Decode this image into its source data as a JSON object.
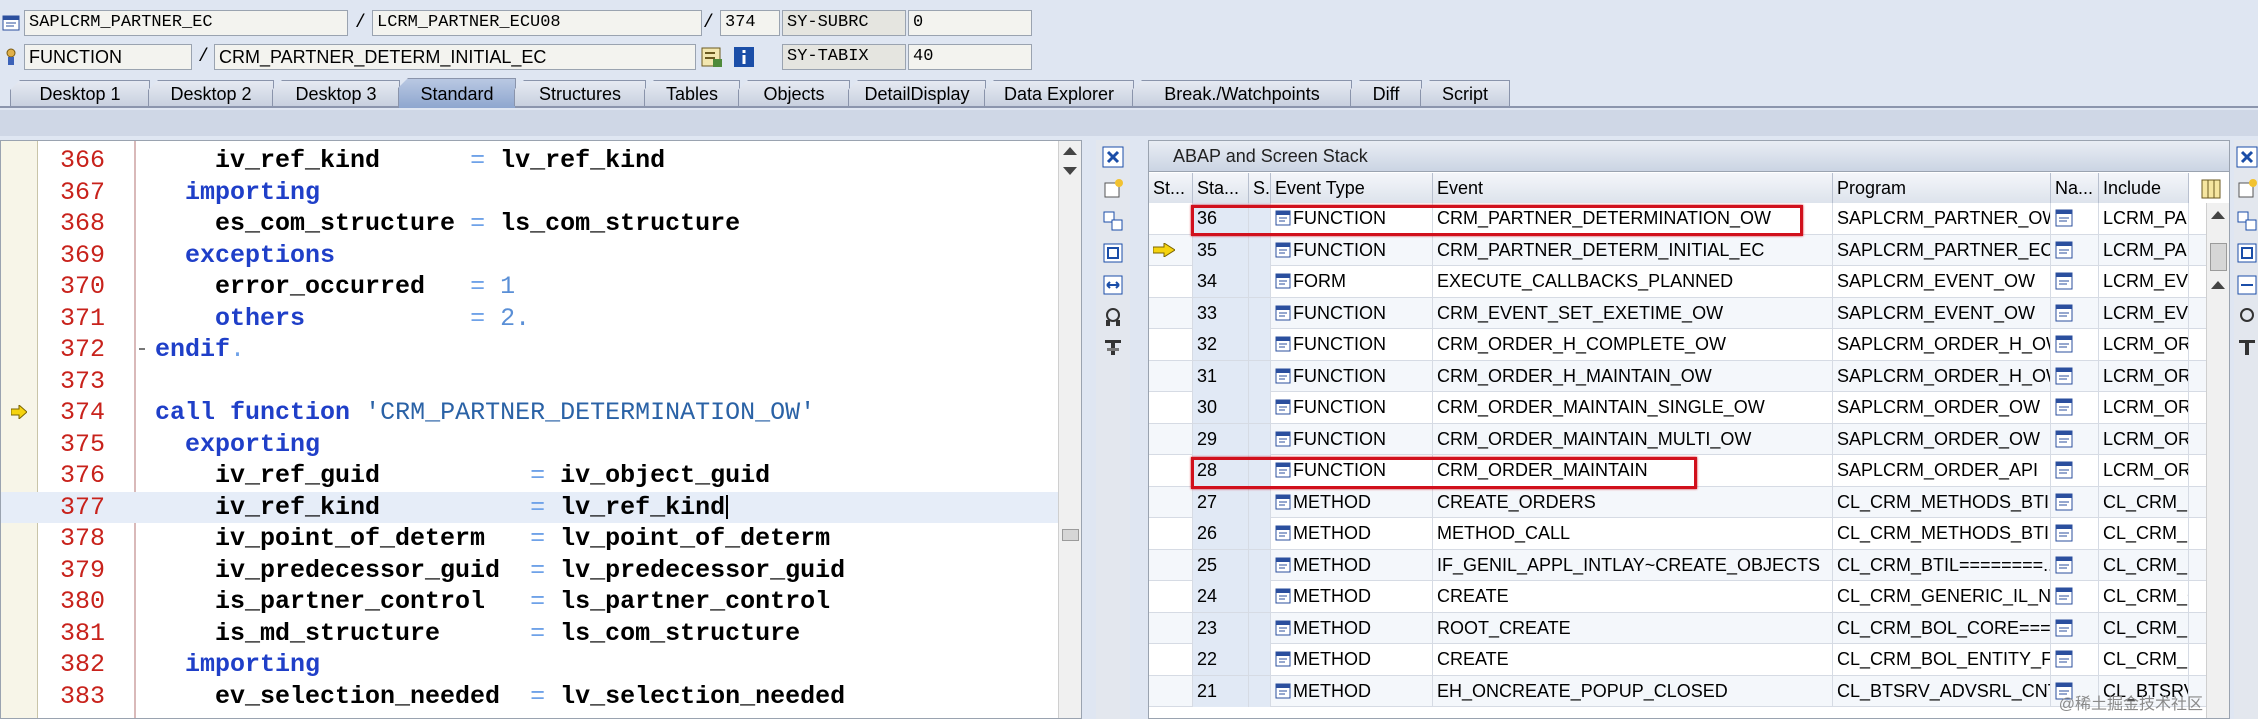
{
  "header": {
    "row1": {
      "program": "SAPLCRM_PARTNER_EC",
      "include": "LCRM_PARTNER_ECU08",
      "line": "374",
      "sysvar": "SY-SUBRC",
      "sysval": "0"
    },
    "row2": {
      "event_type": "FUNCTION",
      "event": "CRM_PARTNER_DETERM_INITIAL_EC",
      "sysvar": "SY-TABIX",
      "sysval": "40"
    },
    "sep": "/"
  },
  "tabs": [
    "Desktop 1",
    "Desktop 2",
    "Desktop 3",
    "Standard",
    "Structures",
    "Tables",
    "Objects",
    "DetailDisplay",
    "Data Explorer",
    "Break./Watchpoints",
    "Diff",
    "Script"
  ],
  "active_tab": "Standard",
  "code": {
    "lines": [
      {
        "n": "366",
        "text": "    iv_ref_kind      = lv_ref_kind"
      },
      {
        "n": "367",
        "text": "  importing"
      },
      {
        "n": "368",
        "text": "    es_com_structure = ls_com_structure"
      },
      {
        "n": "369",
        "text": "  exceptions"
      },
      {
        "n": "370",
        "text": "    error_occurred   = 1"
      },
      {
        "n": "371",
        "text": "    others           = 2."
      },
      {
        "n": "372",
        "text": "endif."
      },
      {
        "n": "373",
        "text": ""
      },
      {
        "n": "374",
        "text": "call function 'CRM_PARTNER_DETERMINATION_OW'"
      },
      {
        "n": "375",
        "text": "  exporting"
      },
      {
        "n": "376",
        "text": "    iv_ref_guid          = iv_object_guid"
      },
      {
        "n": "377",
        "text": "    iv_ref_kind          = lv_ref_kind"
      },
      {
        "n": "378",
        "text": "    iv_point_of_determ   = lv_point_of_determ"
      },
      {
        "n": "379",
        "text": "    iv_predecessor_guid  = lv_predecessor_guid"
      },
      {
        "n": "380",
        "text": "    is_partner_control   = ls_partner_control"
      },
      {
        "n": "381",
        "text": "    is_md_structure      = ls_com_structure"
      },
      {
        "n": "382",
        "text": "  importing"
      },
      {
        "n": "383",
        "text": "    ev_selection_needed  = lv_selection_needed"
      }
    ]
  },
  "stack": {
    "title": "ABAP and Screen Stack",
    "columns": [
      "St...",
      "Sta...",
      "S...",
      "Event Type",
      "Event",
      "Program",
      "Na...",
      "Include"
    ],
    "rows": [
      {
        "sta": "36",
        "type": "FUNCTION",
        "event": "CRM_PARTNER_DETERMINATION_OW",
        "program": "SAPLCRM_PARTNER_OW",
        "include": "LCRM_PAR"
      },
      {
        "sta": "35",
        "type": "FUNCTION",
        "event": "CRM_PARTNER_DETERM_INITIAL_EC",
        "program": "SAPLCRM_PARTNER_EC",
        "include": "LCRM_PAR"
      },
      {
        "sta": "34",
        "type": "FORM",
        "event": "EXECUTE_CALLBACKS_PLANNED",
        "program": "SAPLCRM_EVENT_OW",
        "include": "LCRM_EVE"
      },
      {
        "sta": "33",
        "type": "FUNCTION",
        "event": "CRM_EVENT_SET_EXETIME_OW",
        "program": "SAPLCRM_EVENT_OW",
        "include": "LCRM_EVE"
      },
      {
        "sta": "32",
        "type": "FUNCTION",
        "event": "CRM_ORDER_H_COMPLETE_OW",
        "program": "SAPLCRM_ORDER_H_OW",
        "include": "LCRM_ORD"
      },
      {
        "sta": "31",
        "type": "FUNCTION",
        "event": "CRM_ORDER_H_MAINTAIN_OW",
        "program": "SAPLCRM_ORDER_H_OW",
        "include": "LCRM_ORD"
      },
      {
        "sta": "30",
        "type": "FUNCTION",
        "event": "CRM_ORDER_MAINTAIN_SINGLE_OW",
        "program": "SAPLCRM_ORDER_OW",
        "include": "LCRM_ORD"
      },
      {
        "sta": "29",
        "type": "FUNCTION",
        "event": "CRM_ORDER_MAINTAIN_MULTI_OW",
        "program": "SAPLCRM_ORDER_OW",
        "include": "LCRM_ORD"
      },
      {
        "sta": "28",
        "type": "FUNCTION",
        "event": "CRM_ORDER_MAINTAIN",
        "program": "SAPLCRM_ORDER_API",
        "include": "LCRM_ORD"
      },
      {
        "sta": "27",
        "type": "METHOD",
        "event": "CREATE_ORDERS",
        "program": "CL_CRM_METHODS_BTIL...",
        "include": "CL_CRM_M"
      },
      {
        "sta": "26",
        "type": "METHOD",
        "event": "METHOD_CALL",
        "program": "CL_CRM_METHODS_BTIL...",
        "include": "CL_CRM_M"
      },
      {
        "sta": "25",
        "type": "METHOD",
        "event": "IF_GENIL_APPL_INTLAY~CREATE_OBJECTS",
        "program": "CL_CRM_BTIL========...",
        "include": "CL_CRM_B"
      },
      {
        "sta": "24",
        "type": "METHOD",
        "event": "CREATE",
        "program": "CL_CRM_GENERIC_IL_NE...",
        "include": "CL_CRM_G"
      },
      {
        "sta": "23",
        "type": "METHOD",
        "event": "ROOT_CREATE",
        "program": "CL_CRM_BOL_CORE===...",
        "include": "CL_CRM_B"
      },
      {
        "sta": "22",
        "type": "METHOD",
        "event": "CREATE",
        "program": "CL_CRM_BOL_ENTITY_F...",
        "include": "CL_CRM_B"
      },
      {
        "sta": "21",
        "type": "METHOD",
        "event": "EH_ONCREATE_POPUP_CLOSED",
        "program": "CL_BTSRV_ADVSRL_CNT...",
        "include": "CL_BTSRV"
      }
    ]
  },
  "watermark": "@稀土掘金技术社区",
  "colors": {
    "highlight_box": "#d1101c",
    "line_number": "#c8221b",
    "keyword": "#1f3fc8",
    "string": "#2a62a6"
  }
}
